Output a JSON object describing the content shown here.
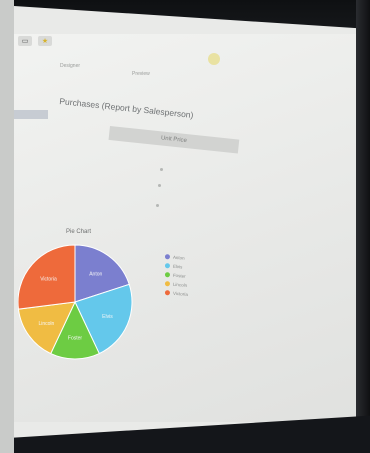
{
  "toolbar": {
    "icons": [
      "window-icon",
      "star-icon"
    ]
  },
  "tabs": [
    {
      "label": "Designer"
    },
    {
      "label": "Preview"
    }
  ],
  "report": {
    "title": "Purchases (Report by Salesperson)",
    "column_header": "Unit Price"
  },
  "sidebar": {
    "items": [
      "",
      "",
      "",
      "",
      ""
    ]
  },
  "chart": {
    "title": "Pie Chart"
  },
  "chart_data": {
    "type": "pie",
    "title": "Pie Chart",
    "categories": [
      "Anton",
      "Elvis",
      "Foster",
      "Lincoln",
      "Victoria"
    ],
    "values": [
      20,
      23,
      14,
      16,
      27
    ],
    "colors": [
      "#7b7fcf",
      "#64c8eb",
      "#6dcc43",
      "#f0bc43",
      "#ee6a3b"
    ],
    "legend": "right"
  }
}
